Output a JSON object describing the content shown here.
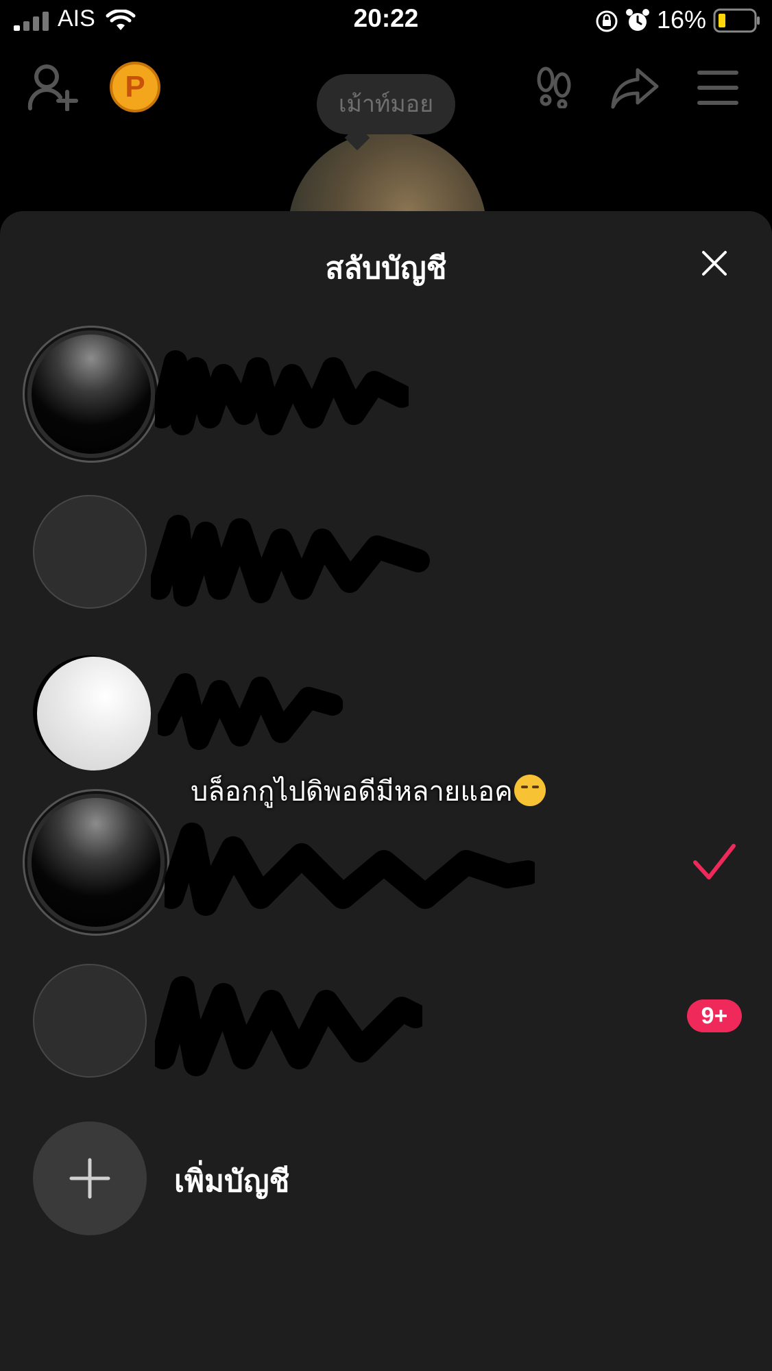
{
  "status_bar": {
    "carrier": "AIS",
    "time": "20:22",
    "battery_percent": "16%",
    "icons": [
      "signal-icon",
      "wifi-icon",
      "rotation-lock-icon",
      "alarm-icon",
      "battery-icon"
    ]
  },
  "header": {
    "status_bubble": "เม้าท์มอย",
    "points_badge": "P",
    "icons": [
      "add-user-icon",
      "points-badge",
      "footprint-icon",
      "share-icon",
      "menu-icon"
    ]
  },
  "sheet": {
    "title": "สลับบัญชี",
    "close_icon": "close-icon",
    "accounts": [
      {
        "avatar": "dark",
        "name_redacted": true,
        "selected": false,
        "badge": ""
      },
      {
        "avatar": "empty",
        "name_redacted": true,
        "selected": false,
        "badge": ""
      },
      {
        "avatar": "white",
        "name_redacted": true,
        "selected": false,
        "badge": ""
      },
      {
        "avatar": "dark",
        "name_redacted": true,
        "selected": true,
        "badge": ""
      },
      {
        "avatar": "empty",
        "name_redacted": true,
        "selected": false,
        "badge": "9+"
      }
    ],
    "add_account_label": "เพิ่มบัญชี"
  },
  "caption": {
    "text": "บล็อกกูไปดิพอดีมีหลายแอค",
    "emoji": "smirk-emoji"
  },
  "colors": {
    "accent": "#ef2a5a",
    "sheet_bg": "#1e1e1e",
    "page_bg": "#000000"
  }
}
